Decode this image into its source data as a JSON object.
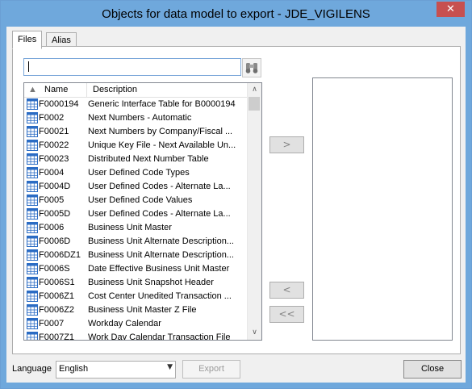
{
  "window": {
    "title": "Objects for data model to export - JDE_VIGILENS",
    "close_glyph": "✕"
  },
  "tabs": [
    {
      "label": "Files"
    },
    {
      "label": "Alias"
    }
  ],
  "search": {
    "value": ""
  },
  "list": {
    "columns": {
      "name": "Name",
      "description": "Description"
    },
    "rows": [
      {
        "name": "F0000194",
        "description": "Generic Interface Table for B0000194"
      },
      {
        "name": "F0002",
        "description": "Next Numbers - Automatic"
      },
      {
        "name": "F00021",
        "description": "Next Numbers by Company/Fiscal ..."
      },
      {
        "name": "F00022",
        "description": "Unique Key File - Next Available Un..."
      },
      {
        "name": "F00023",
        "description": "Distributed Next Number Table"
      },
      {
        "name": "F0004",
        "description": "User Defined Code Types"
      },
      {
        "name": "F0004D",
        "description": "User Defined Codes - Alternate La..."
      },
      {
        "name": "F0005",
        "description": "User Defined Code Values"
      },
      {
        "name": "F0005D",
        "description": "User Defined Codes - Alternate La..."
      },
      {
        "name": "F0006",
        "description": "Business Unit Master"
      },
      {
        "name": "F0006D",
        "description": "Business Unit Alternate Description..."
      },
      {
        "name": "F0006DZ1",
        "description": "Business Unit Alternate Description..."
      },
      {
        "name": "F0006S",
        "description": "Date Effective Business Unit Master"
      },
      {
        "name": "F0006S1",
        "description": "Business Unit Snapshot Header"
      },
      {
        "name": "F0006Z1",
        "description": "Cost Center Unedited Transaction ..."
      },
      {
        "name": "F0006Z2",
        "description": "Business Unit Master Z  File"
      },
      {
        "name": "F0007",
        "description": "Workday Calendar"
      },
      {
        "name": "F0007Z1",
        "description": "Work Day Calendar Transaction File"
      }
    ]
  },
  "transfer_buttons": {
    "add": ">",
    "remove": "<",
    "remove_all": "<<"
  },
  "footer": {
    "language_label": "Language",
    "language_value": "English",
    "export_label": "Export",
    "close_label": "Close"
  },
  "colors": {
    "title_bar": "#6fa8dc",
    "close_button": "#c75050",
    "table_icon": "#2b6cc4"
  }
}
